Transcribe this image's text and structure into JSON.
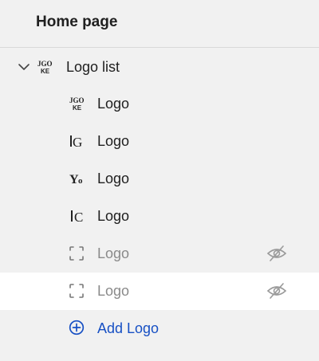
{
  "header": {
    "title": "Home page"
  },
  "tree": {
    "parent": {
      "label": "Logo list",
      "thumb": "logo-nike-thumb"
    },
    "items": [
      {
        "label": "Logo",
        "thumb": "logo-nike-thumb",
        "hidden": false
      },
      {
        "label": "Logo",
        "thumb": "logo-g-thumb",
        "hidden": false
      },
      {
        "label": "Logo",
        "thumb": "logo-blackletter-thumb",
        "hidden": false
      },
      {
        "label": "Logo",
        "thumb": "logo-serif-c-thumb",
        "hidden": false
      },
      {
        "label": "Logo",
        "thumb": "image-placeholder-icon",
        "hidden": true
      },
      {
        "label": "Logo",
        "thumb": "image-placeholder-icon",
        "hidden": true
      }
    ],
    "add_label": "Add Logo"
  },
  "colors": {
    "link": "#1750c4",
    "muted": "#8a8a8a",
    "background": "#f1f1f1",
    "hover": "#ffffff"
  }
}
